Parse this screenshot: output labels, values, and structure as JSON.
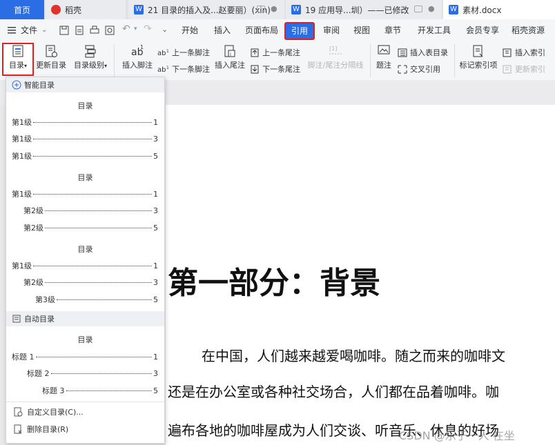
{
  "tabs": [
    {
      "label": "首页",
      "active": true
    },
    {
      "label": "稻壳"
    },
    {
      "label": "21 目录的插入及...赵要丽）(xin)"
    },
    {
      "label": "19  应用导...圳）——已修改"
    },
    {
      "label": "素材.docx"
    }
  ],
  "menu": {
    "file": "文件",
    "items": [
      "开始",
      "插入",
      "页面布局",
      "引用",
      "审阅",
      "视图",
      "章节",
      "开发工具",
      "会员专享",
      "稻壳资源"
    ],
    "active": "引用"
  },
  "ribbon": {
    "toc": "目录",
    "update_toc": "更新目录",
    "toc_level": "目录级别",
    "insert_footnote": "插入脚注",
    "prev_footnote": "上一条脚注",
    "next_footnote": "下一条脚注",
    "insert_endnote": "插入尾注",
    "prev_endnote": "上一条尾注",
    "next_endnote": "下一条尾注",
    "separator": "脚注/尾注分隔线",
    "caption": "题注",
    "insert_table_of_figures": "插入表目录",
    "cross_ref": "交叉引用",
    "mark_index": "标记索引项",
    "insert_index": "插入索引",
    "update_index": "更新索引"
  },
  "dropdown": {
    "smart_header": "智能目录",
    "auto_header": "自动目录",
    "blocks": [
      {
        "title": "目录",
        "rows": [
          {
            "label": "第1级",
            "page": "1",
            "indent": 0
          },
          {
            "label": "第1级",
            "page": "3",
            "indent": 0
          },
          {
            "label": "第1级",
            "page": "5",
            "indent": 0
          }
        ]
      },
      {
        "title": "目录",
        "rows": [
          {
            "label": "第1级",
            "page": "1",
            "indent": 0
          },
          {
            "label": "第2级",
            "page": "3",
            "indent": 1
          },
          {
            "label": "第2级",
            "page": "5",
            "indent": 1
          }
        ]
      },
      {
        "title": "目录",
        "rows": [
          {
            "label": "第1级",
            "page": "1",
            "indent": 0
          },
          {
            "label": "第2级",
            "page": "3",
            "indent": 1
          },
          {
            "label": "第3级",
            "page": "5",
            "indent": 2
          }
        ]
      }
    ],
    "auto_block": {
      "title": "目录",
      "rows": [
        {
          "label": "标题 1",
          "page": "1",
          "indent": 0
        },
        {
          "label": "标题 2",
          "page": "3",
          "indent": 1
        },
        {
          "label": "标题 3",
          "page": "5",
          "indent": 2
        }
      ]
    },
    "custom": "自定义目录(C)...",
    "delete": "删除目录(R)"
  },
  "document": {
    "heading": "第一部分：背景",
    "lines": [
      "在中国，人们越来越爱喝咖啡。随之而来的咖啡文",
      "还是在办公室或各种社交场合，人们都在品着咖啡。咖",
      "遍布各地的咖啡屋成为人们交谈、听音乐、休息的好场"
    ]
  },
  "watermark": "CSDN @乐于一人 在坐",
  "colors": {
    "accent": "#2b6de5",
    "highlight_border": "#e02020"
  }
}
